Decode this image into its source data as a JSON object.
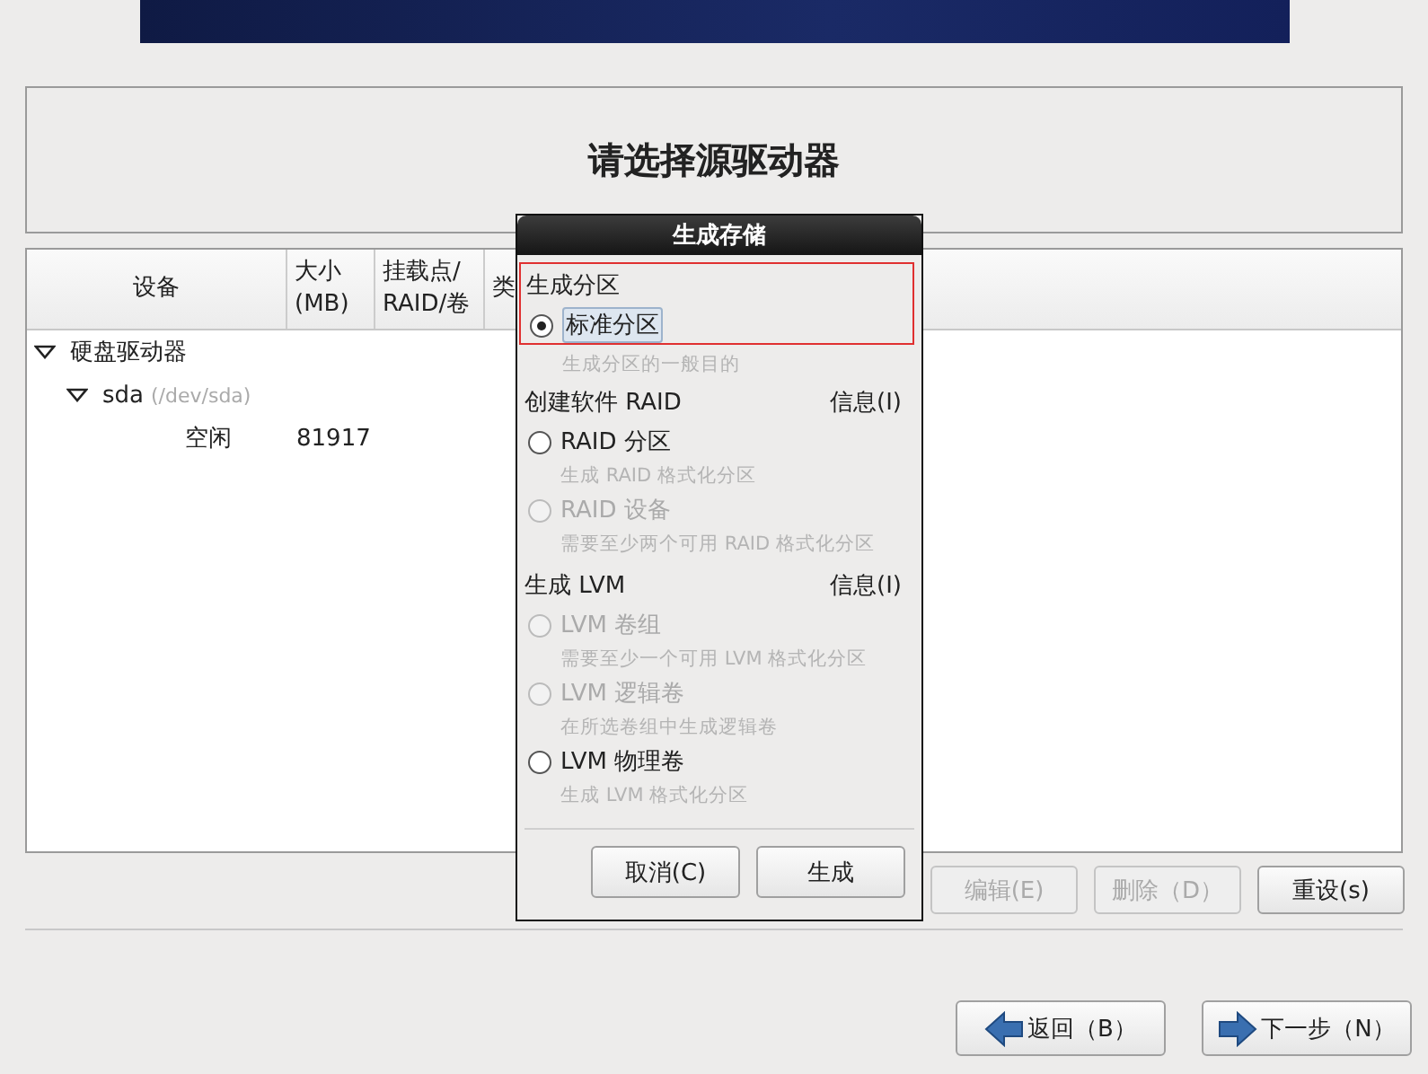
{
  "header": {
    "title": "请选择源驱动器"
  },
  "table": {
    "columns": [
      "设备",
      "大小\n(MB)",
      "挂载点/\nRAID/卷",
      "类"
    ],
    "rows": [
      {
        "label": "硬盘驱动器",
        "expanded": true,
        "children": [
          {
            "label": "sda",
            "detail": "(/dev/sda)",
            "expanded": true,
            "children": [
              {
                "label": "空闲",
                "size": "81917"
              }
            ]
          }
        ]
      }
    ]
  },
  "table_buttons": [
    {
      "label": "编辑(E)",
      "disabled": true
    },
    {
      "label": "删除（D）",
      "disabled": true
    },
    {
      "label": "重设(s)",
      "disabled": false
    }
  ],
  "nav_buttons": [
    {
      "label": "返回（B）",
      "kind": "back"
    },
    {
      "label": "下一步（N）",
      "kind": "next"
    }
  ],
  "dialog": {
    "title": "生成存储",
    "sections": [
      {
        "title": "生成分区",
        "highlighted": true,
        "options": [
          {
            "label": "标准分区",
            "description": "生成分区的一般目的",
            "selected": true,
            "disabled": false
          }
        ]
      },
      {
        "title": "创建软件 RAID",
        "info": "信息(I)",
        "highlighted": false,
        "options": [
          {
            "label": "RAID 分区",
            "description": "生成 RAID 格式化分区",
            "selected": false,
            "disabled": false
          },
          {
            "label": "RAID 设备",
            "description": "需要至少两个可用 RAID 格式化分区",
            "selected": false,
            "disabled": true
          }
        ]
      },
      {
        "title": "生成 LVM",
        "info": "信息(I)",
        "highlighted": false,
        "options": [
          {
            "label": "LVM 卷组",
            "description": "需要至少一个可用 LVM 格式化分区",
            "selected": false,
            "disabled": true
          },
          {
            "label": "LVM 逻辑卷",
            "description": "在所选卷组中生成逻辑卷",
            "selected": false,
            "disabled": true
          },
          {
            "label": "LVM 物理卷",
            "description": "生成 LVM 格式化分区",
            "selected": false,
            "disabled": false
          }
        ]
      }
    ],
    "buttons": [
      "取消(C)",
      "生成"
    ]
  }
}
